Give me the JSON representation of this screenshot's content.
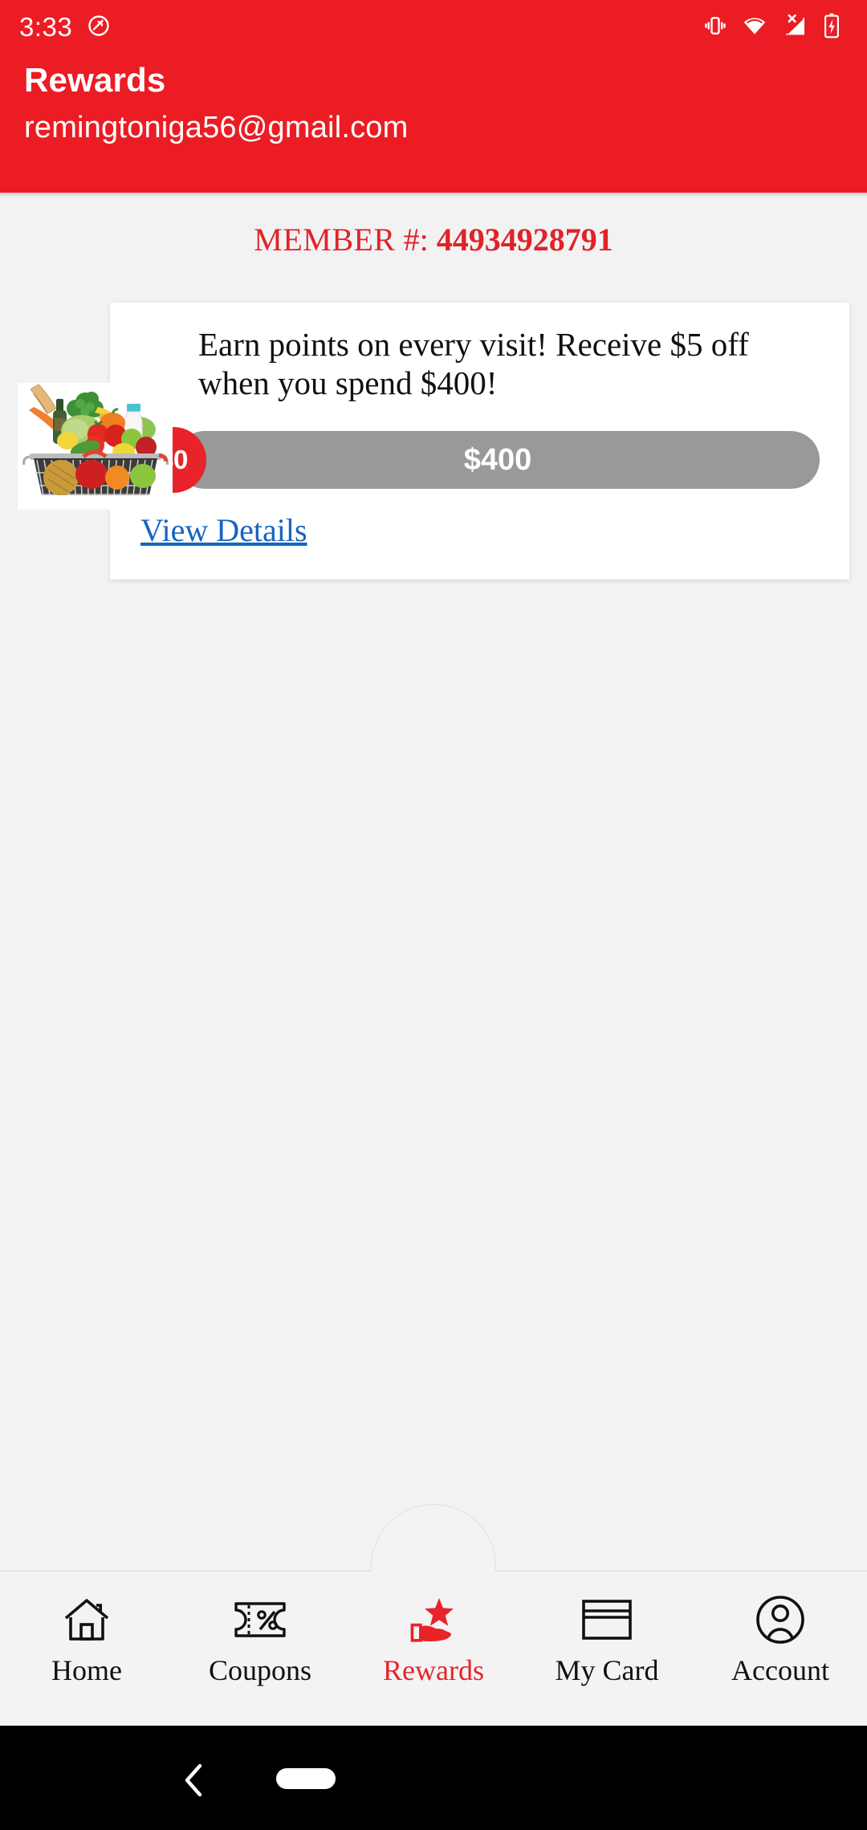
{
  "status_bar": {
    "time": "3:33",
    "left_icons": [
      "do-not-disturb-icon"
    ],
    "right_icons": [
      "vibrate-icon",
      "wifi-icon",
      "no-sim-signal-icon",
      "battery-charging-icon"
    ]
  },
  "header": {
    "title": "Rewards",
    "email": "remingtoniga56@gmail.com",
    "background_color": "#EC1C24",
    "text_color": "#FFFFFF"
  },
  "member": {
    "label": "MEMBER",
    "hash": "#:",
    "number": "44934928791",
    "color": "#E02229"
  },
  "reward_card": {
    "headline": "Earn points on every visit! Receive $5 off when you spend $400!",
    "image_name": "grocery-basket-photo",
    "progress": {
      "current_label": "$0",
      "goal_label": "$400",
      "current_value": 0,
      "goal_value": 400,
      "percent": 0,
      "track_color": "#999999",
      "bubble_color": "#E8232A"
    },
    "view_details_label": "View Details",
    "link_color": "#1565C0"
  },
  "bottom_nav": {
    "active": "Rewards",
    "items": [
      {
        "label": "Home",
        "icon": "house-icon",
        "active": false
      },
      {
        "label": "Coupons",
        "icon": "coupon-percent-icon",
        "active": false
      },
      {
        "label": "Rewards",
        "icon": "hand-star-icon",
        "active": true
      },
      {
        "label": "My Card",
        "icon": "credit-card-icon",
        "active": false
      },
      {
        "label": "Account",
        "icon": "person-circle-icon",
        "active": false
      }
    ],
    "active_color": "#E8232A",
    "inactive_color": "#111111"
  },
  "android_nav": {
    "back_icon": "back-chevron-icon",
    "home_icon": "home-pill-icon"
  }
}
